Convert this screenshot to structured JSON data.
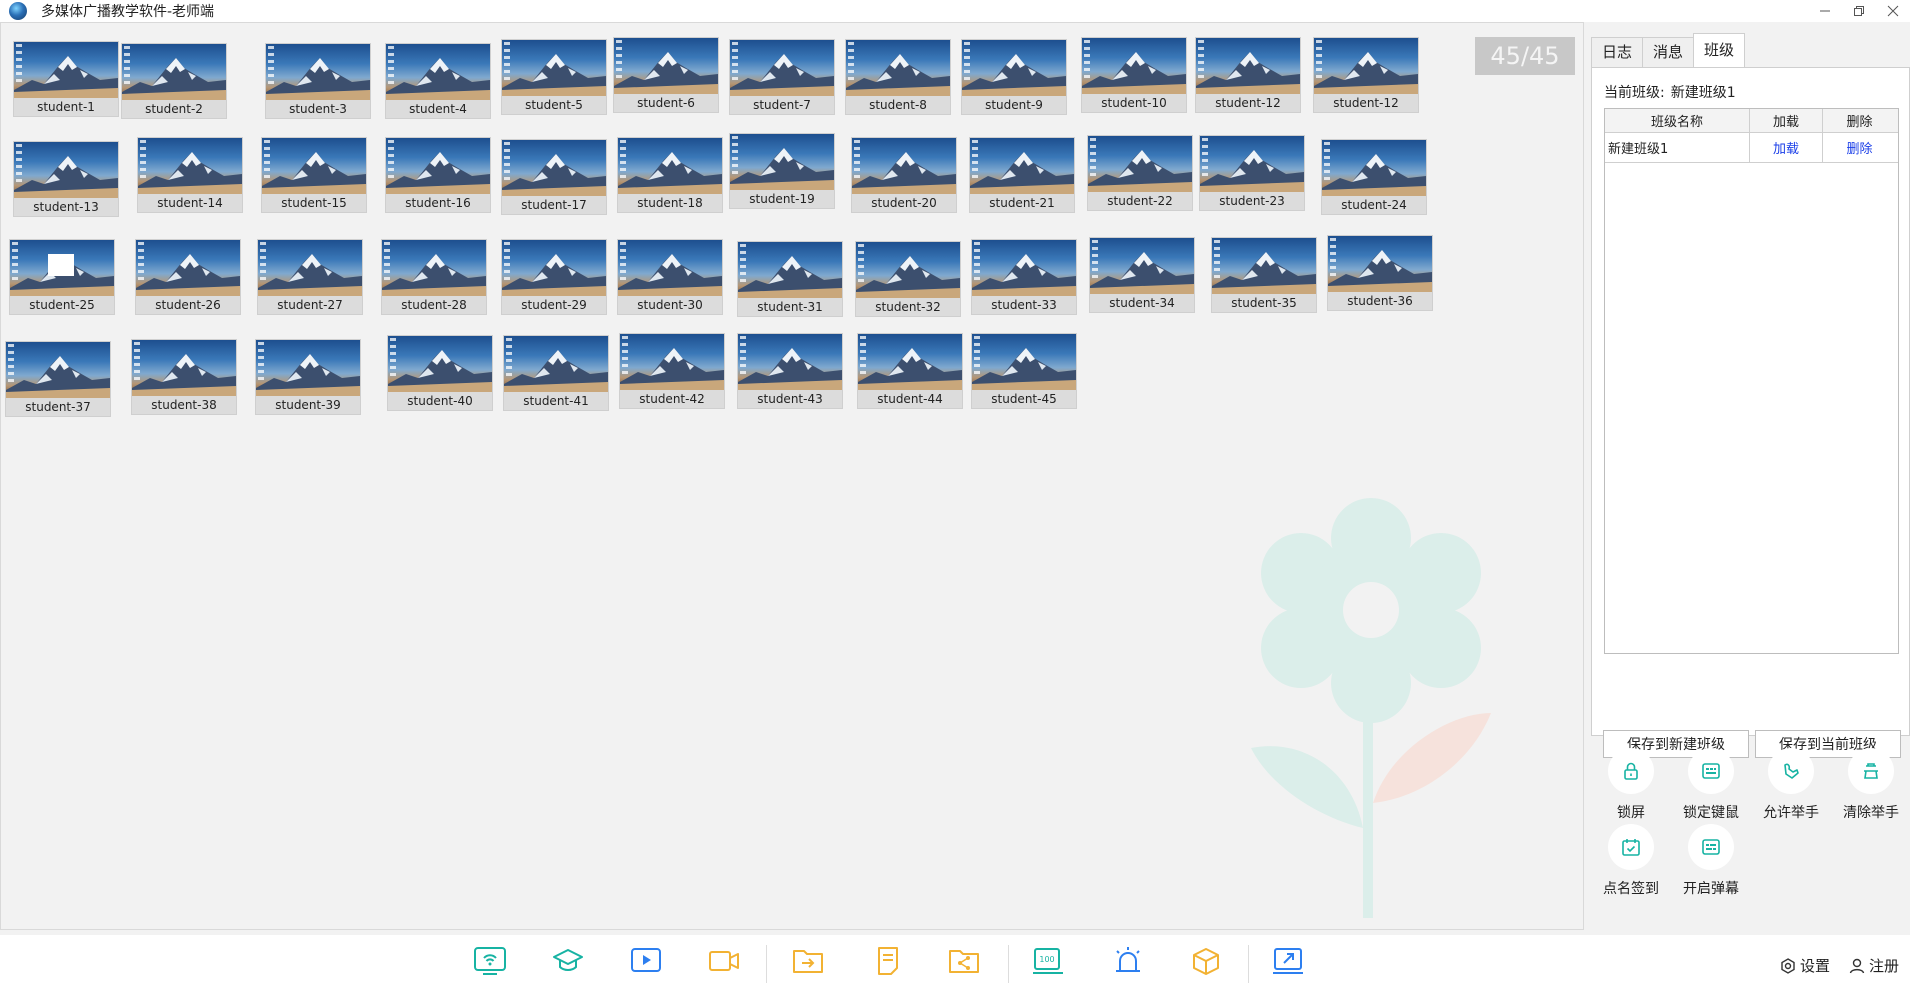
{
  "titlebar": {
    "title": "多媒体广播教学软件-老师端"
  },
  "main": {
    "counter": "45/45"
  },
  "students": [
    "student-1",
    "student-2",
    "student-3",
    "student-4",
    "student-5",
    "student-6",
    "student-7",
    "student-8",
    "student-9",
    "student-10",
    "student-12",
    "student-12",
    "student-13",
    "student-14",
    "student-15",
    "student-16",
    "student-17",
    "student-18",
    "student-19",
    "student-20",
    "student-21",
    "student-22",
    "student-23",
    "student-24",
    "student-25",
    "student-26",
    "student-27",
    "student-28",
    "student-29",
    "student-30",
    "student-31",
    "student-32",
    "student-33",
    "student-34",
    "student-35",
    "student-36",
    "student-37",
    "student-38",
    "student-39",
    "student-40",
    "student-41",
    "student-42",
    "student-43",
    "student-44",
    "student-45"
  ],
  "right_panel": {
    "tabs": [
      {
        "label": "日志"
      },
      {
        "label": "消息"
      },
      {
        "label": "班级"
      }
    ],
    "current_class_label": "当前班级:",
    "current_class_value": "新建班级1",
    "table": {
      "headers": [
        "班级名称",
        "加载",
        "删除"
      ],
      "rows": [
        {
          "name": "新建班级1",
          "load": "加载",
          "delete": "删除"
        }
      ]
    },
    "save_new": "保存到新建班级",
    "save_current": "保存到当前班级"
  },
  "tools": [
    {
      "label": "锁屏",
      "icon": "lock-icon"
    },
    {
      "label": "锁定键鼠",
      "icon": "keyboard-icon"
    },
    {
      "label": "允许举手",
      "icon": "raise-hand-icon"
    },
    {
      "label": "清除举手",
      "icon": "clear-hand-icon"
    },
    {
      "label": "点名签到",
      "icon": "calendar-check-icon"
    },
    {
      "label": "开启弹幕",
      "icon": "danmaku-icon"
    }
  ],
  "bottom_bar": {
    "icons": [
      {
        "name": "broadcast-icon",
        "color": "#17b3a3"
      },
      {
        "name": "graduation-cap-icon",
        "color": "#17b3a3"
      },
      {
        "name": "play-video-icon",
        "color": "#2d7ff0"
      },
      {
        "name": "video-camera-icon",
        "color": "#f2b233"
      },
      {
        "name": "file-send-icon",
        "color": "#f2b233"
      },
      {
        "name": "file-note-icon",
        "color": "#f2b233"
      },
      {
        "name": "share-folder-icon",
        "color": "#f2b233"
      },
      {
        "name": "exam-icon",
        "color": "#17b3a3"
      },
      {
        "name": "alarm-icon",
        "color": "#2d7ff0"
      },
      {
        "name": "package-icon",
        "color": "#f2b233"
      },
      {
        "name": "export-icon",
        "color": "#2d7ff0"
      }
    ],
    "settings": "设置",
    "register": "注册"
  },
  "colors": {
    "accent_blue": "#1a3ee8",
    "teal": "#17b3a3",
    "orange": "#f2b233"
  }
}
